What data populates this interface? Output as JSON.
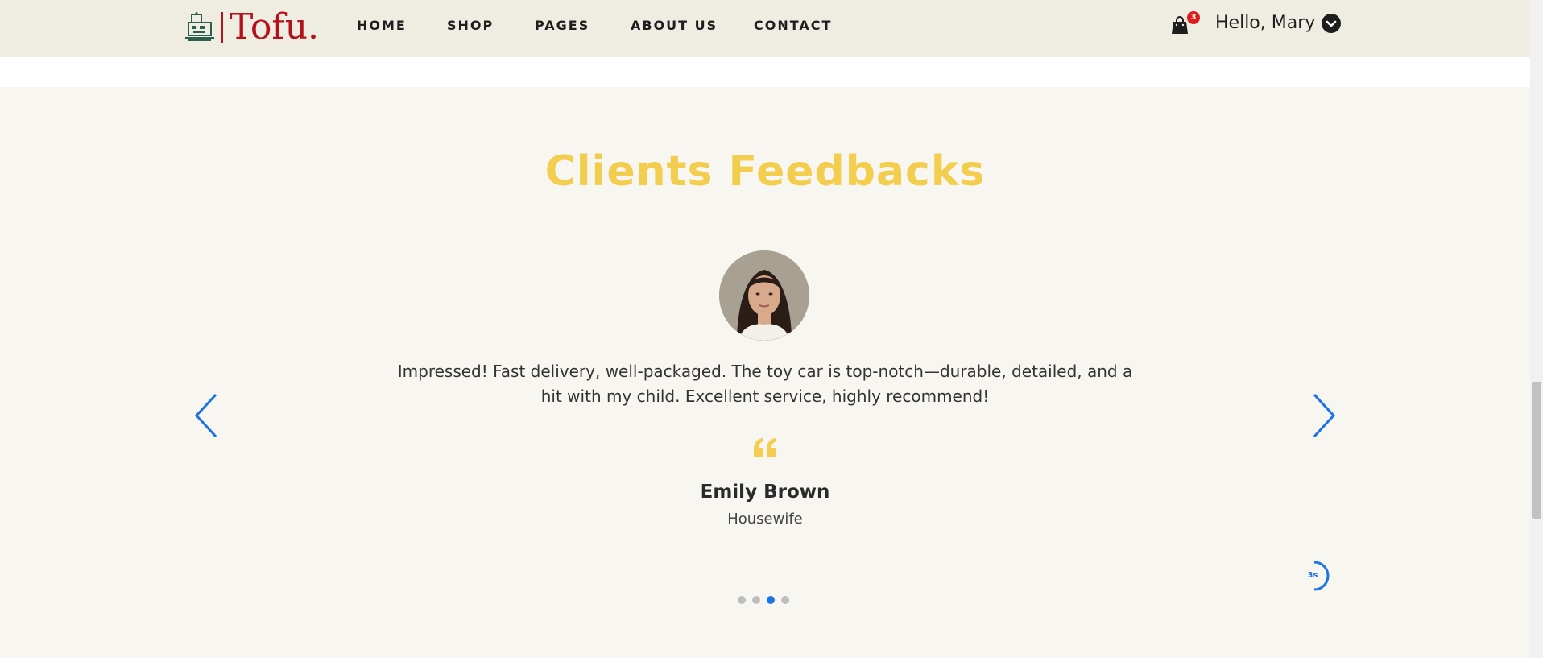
{
  "header": {
    "logo_text": "Tofu.",
    "nav": [
      {
        "label": "HOME"
      },
      {
        "label": "SHOP"
      },
      {
        "label": "PAGES"
      },
      {
        "label": "ABOUT US"
      },
      {
        "label": "CONTACT"
      }
    ],
    "cart_count": "3",
    "greeting": "Hello, Mary",
    "icons": {
      "logo": "toy-robot-icon",
      "cart": "shopping-bag-icon",
      "user_menu": "chevron-down-icon"
    }
  },
  "testimonials": {
    "title": "Clients Feedbacks",
    "quote": "Impressed! Fast delivery, well-packaged. The toy car is top-notch—durable, detailed, and a hit with my child. Excellent service, highly recommend!",
    "name": "Emily Brown",
    "role": "Housewife",
    "timer_label": "3s",
    "slides_total": 4,
    "active_slide": 3,
    "icons": {
      "prev": "chevron-left-icon",
      "next": "chevron-right-icon",
      "quote": "quote-icon",
      "timer": "autoplay-timer-icon"
    }
  },
  "colors": {
    "header_bg": "#efede1",
    "section_bg": "#f7f6f0",
    "brand_red": "#b3121b",
    "title_yellow": "#f3cd4d",
    "accent_blue": "#1a73e8",
    "badge_red": "#e01b1b"
  }
}
